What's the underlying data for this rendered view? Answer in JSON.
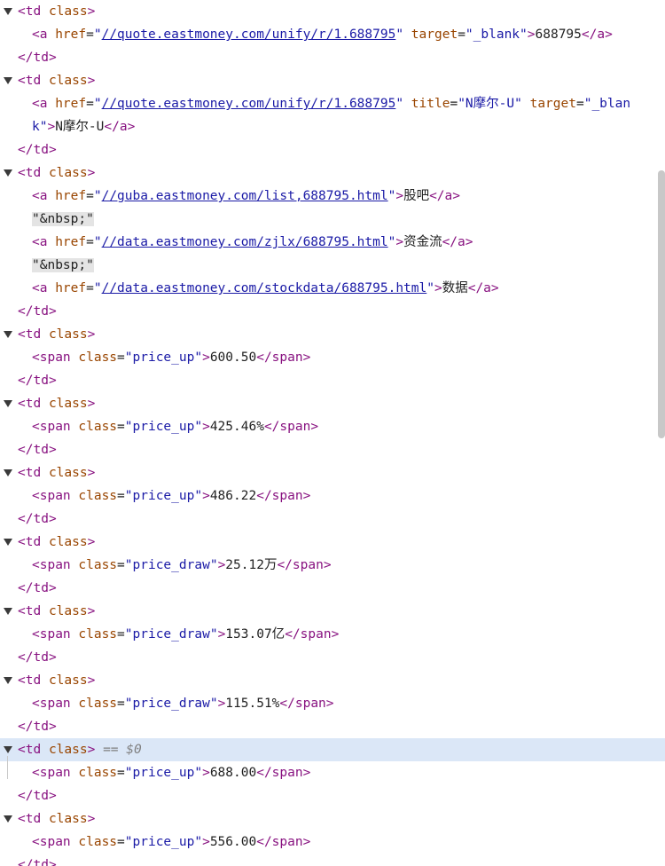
{
  "lines": [
    {
      "k": "open",
      "tag": "td",
      "attr": "class"
    },
    {
      "k": "a",
      "href": "//quote.eastmoney.com/unify/r/1.688795",
      "target": "_blank",
      "text": "688795"
    },
    {
      "k": "close",
      "tag": "td"
    },
    {
      "k": "open",
      "tag": "td",
      "attr": "class"
    },
    {
      "k": "a-title1",
      "href": "//quote.eastmoney.com/unify/r/1.688795",
      "title": "N摩尔-U",
      "target_part1": "_blan"
    },
    {
      "k": "a-title2",
      "target_part2": "k",
      "text": "N摩尔-U"
    },
    {
      "k": "close",
      "tag": "td"
    },
    {
      "k": "open",
      "tag": "td",
      "attr": "class"
    },
    {
      "k": "a-plain",
      "href": "//guba.eastmoney.com/list,688795.html",
      "text": "股吧"
    },
    {
      "k": "nbsp",
      "text": "\"&nbsp;\""
    },
    {
      "k": "a-plain",
      "href": "//data.eastmoney.com/zjlx/688795.html",
      "text": "资金流"
    },
    {
      "k": "nbsp",
      "text": "\"&nbsp;\""
    },
    {
      "k": "a-plain",
      "href": "//data.eastmoney.com/stockdata/688795.html",
      "text": "数据"
    },
    {
      "k": "close",
      "tag": "td"
    },
    {
      "k": "open",
      "tag": "td",
      "attr": "class"
    },
    {
      "k": "span",
      "cls": "price_up",
      "text": "600.50"
    },
    {
      "k": "close",
      "tag": "td"
    },
    {
      "k": "open",
      "tag": "td",
      "attr": "class"
    },
    {
      "k": "span",
      "cls": "price_up",
      "text": "425.46%"
    },
    {
      "k": "close",
      "tag": "td"
    },
    {
      "k": "open",
      "tag": "td",
      "attr": "class"
    },
    {
      "k": "span",
      "cls": "price_up",
      "text": "486.22"
    },
    {
      "k": "close",
      "tag": "td"
    },
    {
      "k": "open",
      "tag": "td",
      "attr": "class"
    },
    {
      "k": "span",
      "cls": "price_draw",
      "text": "25.12万"
    },
    {
      "k": "close",
      "tag": "td"
    },
    {
      "k": "open",
      "tag": "td",
      "attr": "class"
    },
    {
      "k": "span",
      "cls": "price_draw",
      "text": "153.07亿"
    },
    {
      "k": "close",
      "tag": "td"
    },
    {
      "k": "open",
      "tag": "td",
      "attr": "class"
    },
    {
      "k": "span",
      "cls": "price_draw",
      "text": "115.51%"
    },
    {
      "k": "close",
      "tag": "td"
    },
    {
      "k": "open-selected",
      "tag": "td",
      "attr": "class",
      "marker": "== $0"
    },
    {
      "k": "span",
      "cls": "price_up",
      "text": "688.00"
    },
    {
      "k": "close",
      "tag": "td"
    },
    {
      "k": "open",
      "tag": "td",
      "attr": "class"
    },
    {
      "k": "span",
      "cls": "price_up",
      "text": "556.00"
    },
    {
      "k": "close",
      "tag": "td"
    }
  ]
}
